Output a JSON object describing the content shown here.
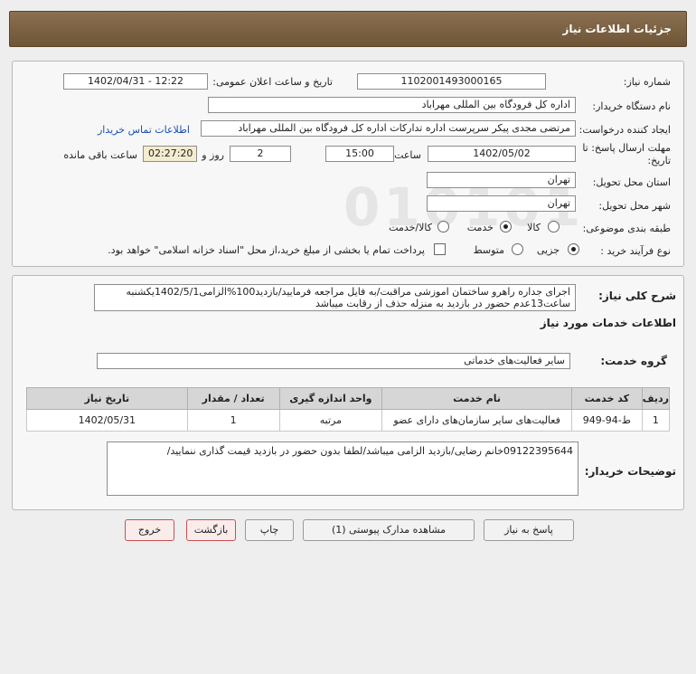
{
  "header": {
    "title": "جزئیات اطلاعات نیاز"
  },
  "info": {
    "need_number_label": "شماره نیاز:",
    "need_number": "1102001493000165",
    "announce_label": "تاریخ و ساعت اعلان عمومی:",
    "announce_value": "1402/04/31 - 12:22",
    "buyer_label": "نام دستگاه خریدار:",
    "buyer_value": "اداره کل فرودگاه بین المللی مهراباد",
    "creator_label": "ایجاد کننده درخواست:",
    "creator_value": "مرتضی مجدی پیکر سرپرست اداره تدارکات  اداره کل فرودگاه بین المللی مهراباد",
    "contact_link": "اطلاعات تماس خریدار",
    "deadline_label": "مهلت ارسال پاسخ: تا تاریخ:",
    "deadline_date": "1402/05/02",
    "hour_label": "ساعت",
    "deadline_time": "15:00",
    "days_value": "2",
    "days_label": "روز و",
    "remaining_value": "02:27:20",
    "remaining_label": "ساعت باقی مانده",
    "province_label": "استان محل تحویل:",
    "province_value": "تهران",
    "city_label": "شهر محل تحویل:",
    "city_value": "تهران",
    "category_label": "طبقه بندی موضوعی:",
    "category_options": [
      "کالا",
      "خدمت",
      "کالا/خدمت"
    ],
    "category_selected": "خدمت",
    "process_label": "نوع فرآیند خرید :",
    "process_options": [
      "جزیی",
      "متوسط"
    ],
    "process_selected": "جزیی",
    "payment_note": "پرداخت تمام یا بخشی از مبلغ خرید،از محل \"اسناد خزانه اسلامی\" خواهد بود."
  },
  "description": {
    "label": "شرح کلی نیاز:",
    "text": "اجرای جداره راهرو ساختمان اموزشی مراقبت/به فایل مراجعه فرمایید/بازدید100%الزامی1402/5/1یکشنبه ساعت13عدم حضور در بازدید به منزله حذف از رقابت میباشد"
  },
  "services": {
    "section_title": "اطلاعات خدمات مورد نیاز",
    "group_label": "گروه خدمت:",
    "group_value": "سایر فعالیت‌های خدماتی",
    "columns": [
      "ردیف",
      "کد خدمت",
      "نام خدمت",
      "واحد اندازه گیری",
      "تعداد / مقدار",
      "تاریخ نیاز"
    ],
    "rows": [
      [
        "1",
        "ط-94-949",
        "فعالیت‌های سایر سازمان‌های دارای عضو",
        "مرتبه",
        "1",
        "1402/05/31"
      ]
    ]
  },
  "buyer_notes": {
    "label": "توضیحات خریدار:",
    "text": "09122395644خانم رضایی/بازدید الزامی میباشد/لطفا بدون حضور در بازدید قیمت گذاری ننمایید/"
  },
  "buttons": {
    "reply": "پاسخ به نیاز",
    "attachments": "مشاهده مدارک پیوستی (1)",
    "print": "چاپ",
    "back": "بازگشت",
    "exit": "خروج"
  }
}
